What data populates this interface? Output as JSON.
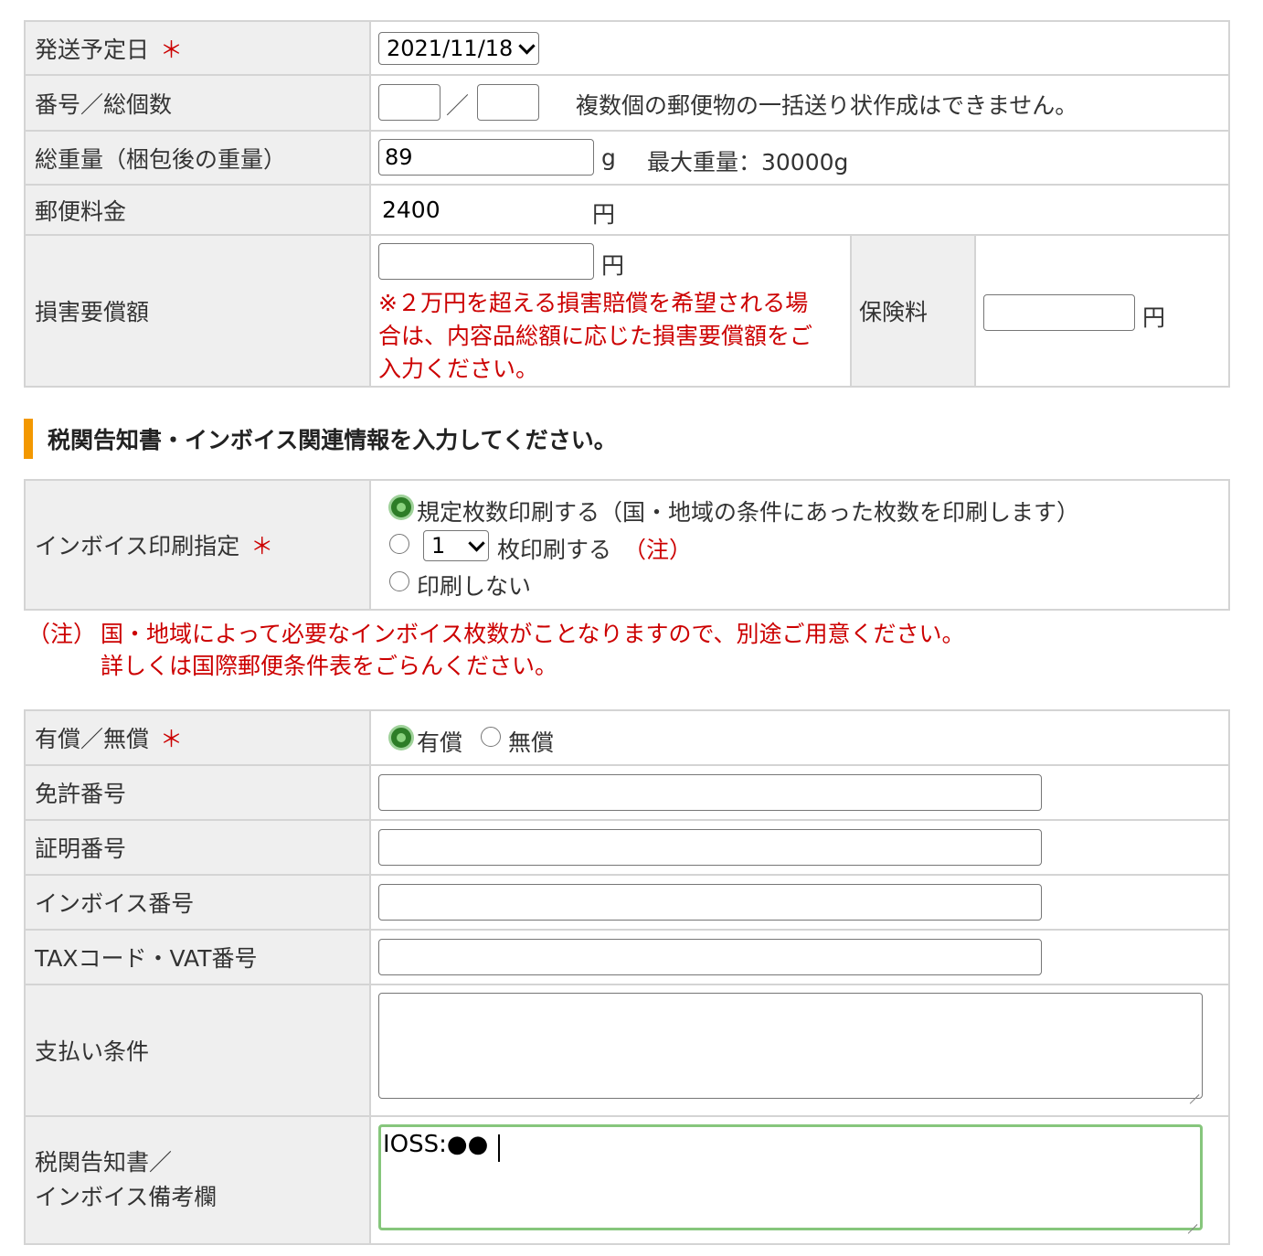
{
  "shipping": {
    "date_label": "発送予定日",
    "required_mark": "＊",
    "date_value": "2021/11/18",
    "number_label": "番号／総個数",
    "number_sep": "／",
    "number_note": "複数個の郵便物の一括送り状作成はできません。",
    "weight_label": "総重量（梱包後の重量）",
    "weight_value": "89",
    "weight_unit": "g",
    "weight_max": "最大重量：30000g",
    "postage_label": "郵便料金",
    "postage_value": "2400",
    "postage_unit": "円",
    "damage_label": "損害要償額",
    "damage_unit": "円",
    "damage_note_1": "※２万円を超える損害賠償を希望される場",
    "damage_note_2": "合は、内容品総額に応じた損害要償額をご",
    "damage_note_3": "入力ください。",
    "insurance_label": "保険料",
    "insurance_unit": "円"
  },
  "section": {
    "title": "税関告知書・インボイス関連情報を入力してください。",
    "accent_color": "#f39800"
  },
  "invoice_print": {
    "label": "インボイス印刷指定",
    "option_default": "規定枚数印刷する（国・地域の条件にあった枚数を印刷します）",
    "count_value": "1",
    "option_count": "枚印刷する",
    "option_count_note": "（注）",
    "option_none": "印刷しない",
    "note_prefix": "（注）",
    "note_line1": "国・地域によって必要なインボイス枚数がことなりますので、別途ご用意ください。",
    "note_line2": "詳しくは国際郵便条件表をごらんください。"
  },
  "customs": {
    "paid_label": "有償／無償",
    "paid_option": "有償",
    "free_option": "無償",
    "license_label": "免許番号",
    "certificate_label": "証明番号",
    "invoice_no_label": "インボイス番号",
    "tax_label": "TAXコード・VAT番号",
    "payment_label": "支払い条件",
    "remarks_label_1": "税関告知書／",
    "remarks_label_2": "インボイス備考欄",
    "remarks_value": "IOSS:●●"
  }
}
